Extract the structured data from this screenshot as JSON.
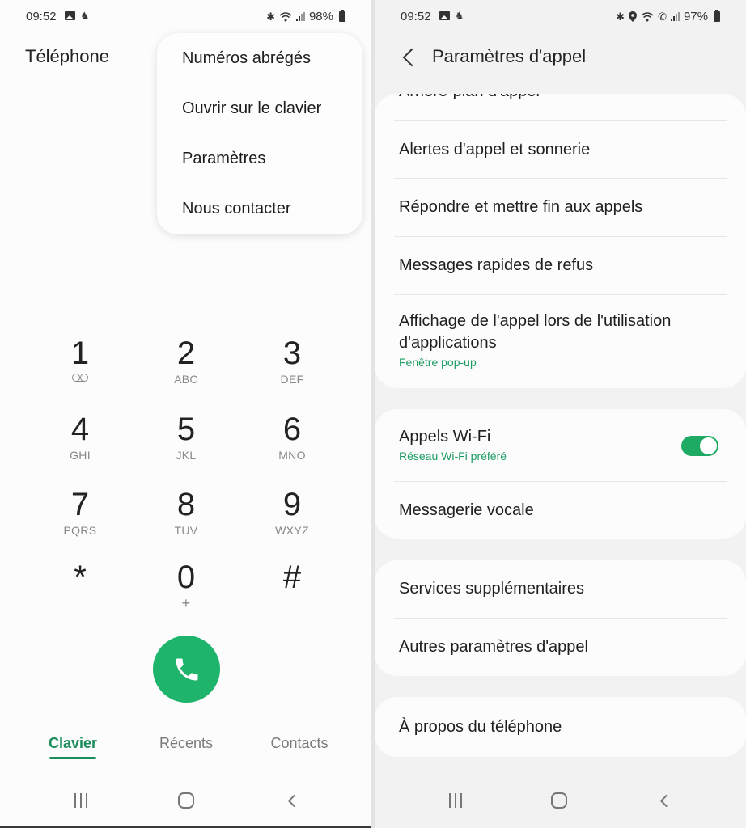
{
  "left_screen": {
    "status_bar": {
      "time": "09:52",
      "left_icons": [
        "gallery-icon",
        "notification-icon"
      ],
      "right_icons": [
        "bluetooth-icon",
        "wifi-icon",
        "signal-icon",
        "battery-icon"
      ],
      "battery": "98%"
    },
    "title": "Téléphone",
    "overflow_menu": {
      "items": [
        "Numéros abrégés",
        "Ouvrir sur le clavier",
        "Paramètres",
        "Nous contacter"
      ]
    },
    "keypad": {
      "keys": [
        {
          "digit": "1",
          "letters": "",
          "icon": "voicemail-icon"
        },
        {
          "digit": "2",
          "letters": "ABC"
        },
        {
          "digit": "3",
          "letters": "DEF"
        },
        {
          "digit": "4",
          "letters": "GHI"
        },
        {
          "digit": "5",
          "letters": "JKL"
        },
        {
          "digit": "6",
          "letters": "MNO"
        },
        {
          "digit": "7",
          "letters": "PQRS"
        },
        {
          "digit": "8",
          "letters": "TUV"
        },
        {
          "digit": "9",
          "letters": "WXYZ"
        },
        {
          "digit": "*",
          "letters": ""
        },
        {
          "digit": "0",
          "letters": "+"
        },
        {
          "digit": "#",
          "letters": ""
        }
      ]
    },
    "call_button_icon": "phone-icon",
    "tabs": [
      {
        "label": "Clavier",
        "active": true
      },
      {
        "label": "Récents",
        "active": false
      },
      {
        "label": "Contacts",
        "active": false
      }
    ]
  },
  "right_screen": {
    "status_bar": {
      "time": "09:52",
      "left_icons": [
        "gallery-icon",
        "notification-icon"
      ],
      "right_icons": [
        "bluetooth-icon",
        "location-icon",
        "wifi-icon",
        "wifi-calling-icon",
        "signal-icon",
        "battery-icon"
      ],
      "battery": "97%"
    },
    "title": "Paramètres d'appel",
    "groups": [
      {
        "items": [
          {
            "title": "Arrière-plan d'appel",
            "partially_visible": true
          },
          {
            "title": "Alertes d'appel et sonnerie"
          },
          {
            "title": "Répondre et mettre fin aux appels"
          },
          {
            "title": "Messages rapides de refus"
          },
          {
            "title": "Affichage de l'appel lors de l'utilisation d'applications",
            "subtitle": "Fenêtre pop-up"
          }
        ]
      },
      {
        "items": [
          {
            "title": "Appels Wi-Fi",
            "subtitle": "Réseau Wi-Fi préféré",
            "toggle": true
          },
          {
            "title": "Messagerie vocale"
          }
        ]
      },
      {
        "items": [
          {
            "title": "Services supplémentaires"
          },
          {
            "title": "Autres paramètres d'appel"
          }
        ]
      },
      {
        "items": [
          {
            "title": "À propos du téléphone"
          }
        ]
      }
    ]
  },
  "navigation_bar": [
    "recent-apps",
    "home",
    "back"
  ],
  "colors": {
    "accent": "#1eb46b",
    "accent_text": "#1b8c5a",
    "subtitle": "#1b9c62"
  }
}
